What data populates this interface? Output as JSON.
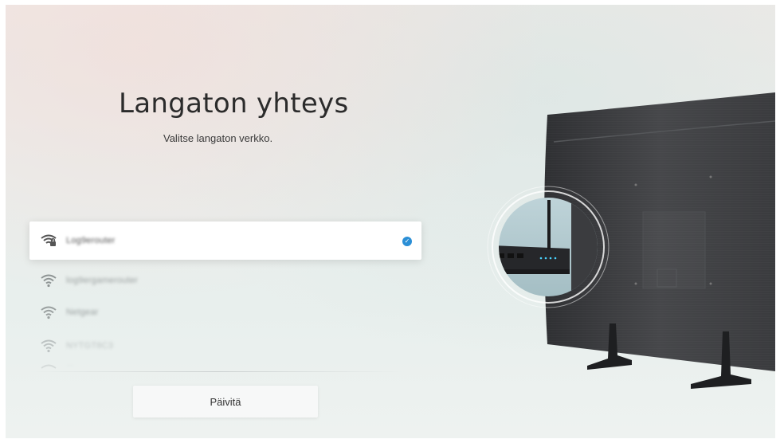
{
  "screen": {
    "title": "Langaton yhteys",
    "subtitle": "Valitse langaton verkko."
  },
  "networks": [
    {
      "name": "Log9erouter",
      "selected": true,
      "secured": true
    },
    {
      "name": "log9ergamerouter",
      "selected": false,
      "secured": false
    },
    {
      "name": "Netgear",
      "selected": false,
      "secured": false
    },
    {
      "name": "NYTGT8C3",
      "selected": false,
      "secured": false
    },
    {
      "name": "...",
      "selected": false,
      "secured": false
    }
  ],
  "refresh_button": {
    "label": "Päivitä"
  },
  "colors": {
    "accent_check": "#2b8fd6",
    "tv_body": "#3e3f42"
  },
  "icons": [
    "wifi-locked-icon",
    "wifi-icon",
    "check-icon",
    "tv-illustration",
    "router-illustration"
  ]
}
